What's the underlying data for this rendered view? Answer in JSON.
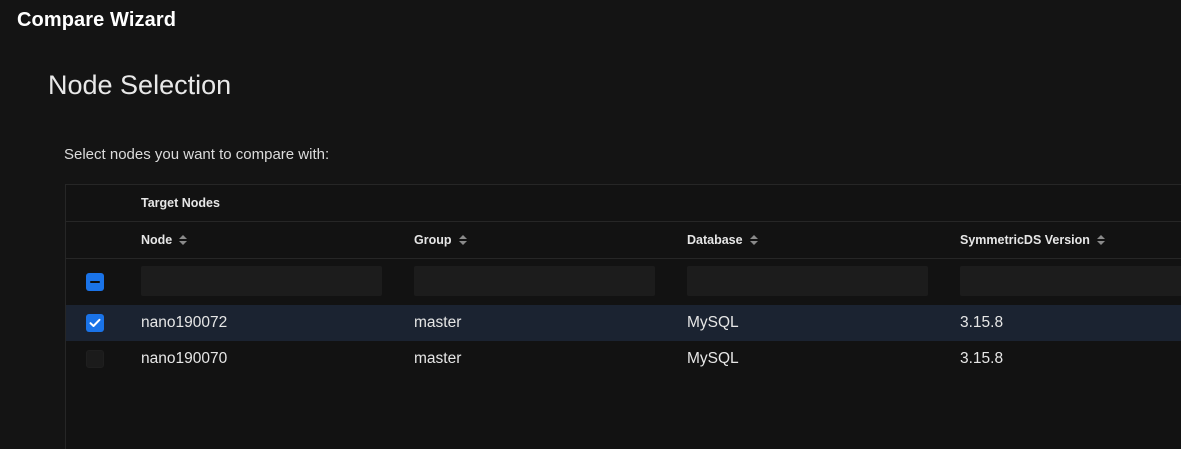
{
  "window": {
    "title": "Compare Wizard"
  },
  "page": {
    "section_title": "Node Selection",
    "instruction": "Select nodes you want to compare with:"
  },
  "grid": {
    "group_header": "Target Nodes",
    "columns": [
      {
        "key": "node",
        "label": "Node",
        "sortable": true
      },
      {
        "key": "group",
        "label": "Group",
        "sortable": true
      },
      {
        "key": "database",
        "label": "Database",
        "sortable": true
      },
      {
        "key": "version",
        "label": "SymmetricDS Version",
        "sortable": true
      }
    ],
    "select_all_state": "indeterminate",
    "filters": {
      "node": "",
      "group": "",
      "database": "",
      "version": ""
    },
    "rows": [
      {
        "checked": true,
        "node": "nano190072",
        "group": "master",
        "database": "MySQL",
        "version": "3.15.8"
      },
      {
        "checked": false,
        "node": "nano190070",
        "group": "master",
        "database": "MySQL",
        "version": "3.15.8"
      }
    ]
  },
  "colors": {
    "background": "#141414",
    "accent": "#1a73e8",
    "selected_row": "#1b2331",
    "border": "#262626"
  }
}
